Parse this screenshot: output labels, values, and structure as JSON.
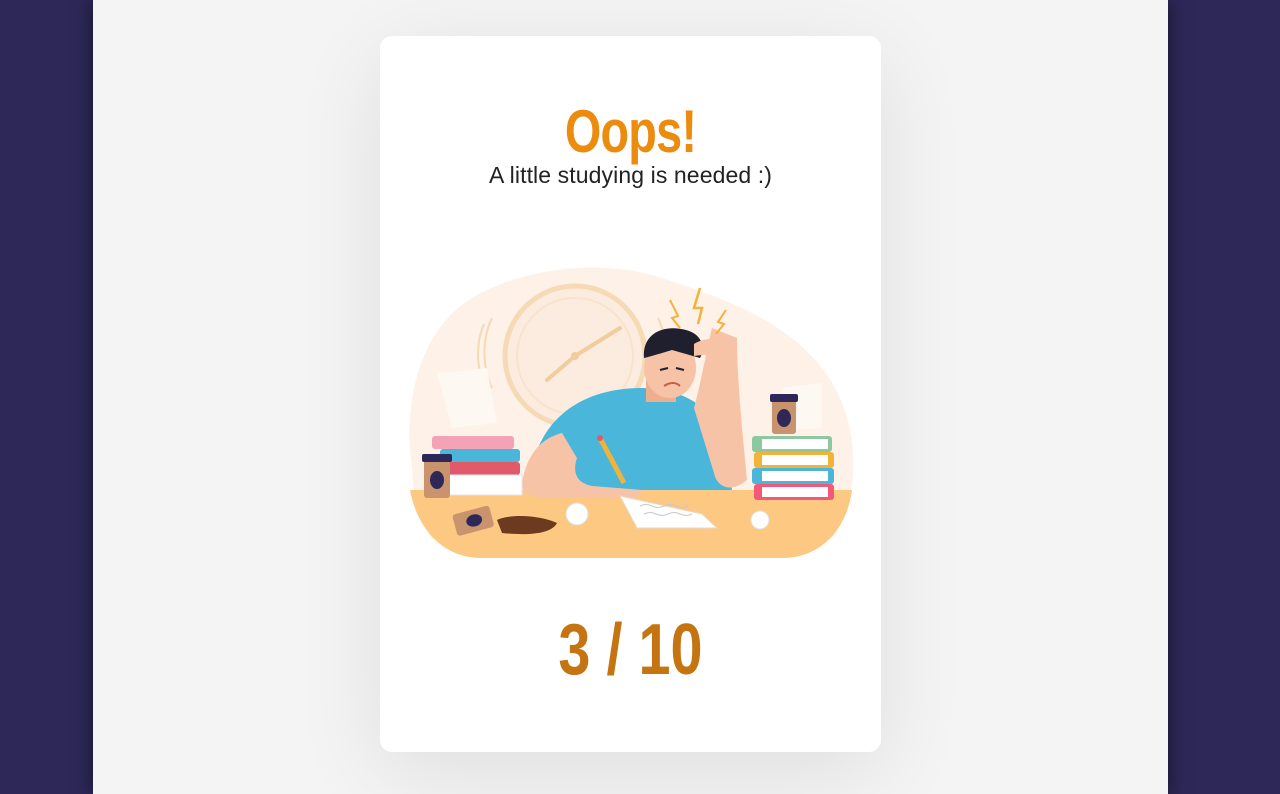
{
  "result": {
    "title": "Oops!",
    "message": "A little studying is needed :)",
    "score": "3 / 10"
  },
  "illustration": {
    "name": "stressed-student-studying-illustration"
  },
  "colors": {
    "background": "#2d2858",
    "page": "#f4f4f4",
    "card": "#ffffff",
    "title": "#ec8c0f",
    "score": "#c57412"
  }
}
